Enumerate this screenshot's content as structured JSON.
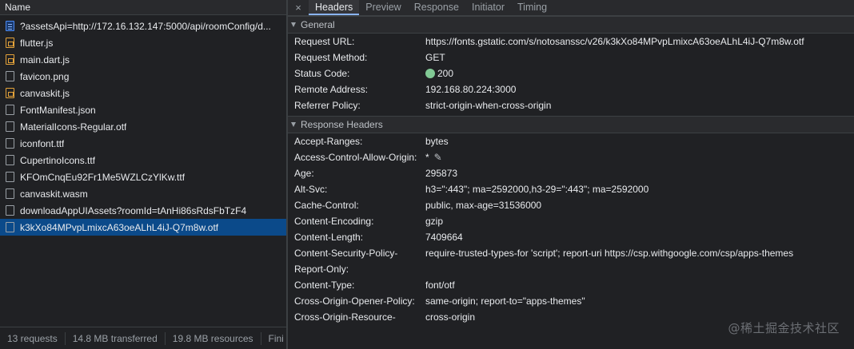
{
  "left": {
    "header": "Name",
    "files": [
      {
        "name": "?assetsApi=http://172.16.132.147:5000/api/roomConfig/d...",
        "icon": "doc"
      },
      {
        "name": "flutter.js",
        "icon": "js"
      },
      {
        "name": "main.dart.js",
        "icon": "js"
      },
      {
        "name": "favicon.png",
        "icon": "plain"
      },
      {
        "name": "canvaskit.js",
        "icon": "js"
      },
      {
        "name": "FontManifest.json",
        "icon": "plain"
      },
      {
        "name": "MaterialIcons-Regular.otf",
        "icon": "plain"
      },
      {
        "name": "iconfont.ttf",
        "icon": "plain"
      },
      {
        "name": "CupertinoIcons.ttf",
        "icon": "plain"
      },
      {
        "name": "KFOmCnqEu92Fr1Me5WZLCzYlKw.ttf",
        "icon": "plain"
      },
      {
        "name": "canvaskit.wasm",
        "icon": "plain"
      },
      {
        "name": "downloadAppUIAssets?roomId=tAnHi86sRdsFbTzF4",
        "icon": "plain"
      },
      {
        "name": "k3kXo84MPvpLmixcA63oeALhL4iJ-Q7m8w.otf",
        "icon": "plain",
        "selected": true
      }
    ],
    "status": {
      "requests": "13 requests",
      "transferred": "14.8 MB transferred",
      "resources": "19.8 MB resources",
      "finish": "Fini"
    }
  },
  "tabs": {
    "close": "×",
    "items": [
      "Headers",
      "Preview",
      "Response",
      "Initiator",
      "Timing"
    ],
    "active": "Headers"
  },
  "general": {
    "title": "General",
    "rows": [
      {
        "key": "Request URL:",
        "value": "https://fonts.gstatic.com/s/notosanssc/v26/k3kXo84MPvpLmixcA63oeALhL4iJ-Q7m8w.otf"
      },
      {
        "key": "Request Method:",
        "value": "GET"
      },
      {
        "key": "Status Code:",
        "value": "200"
      },
      {
        "key": "Remote Address:",
        "value": "192.168.80.224:3000"
      },
      {
        "key": "Referrer Policy:",
        "value": "strict-origin-when-cross-origin"
      }
    ]
  },
  "response_headers": {
    "title": "Response Headers",
    "rows": [
      {
        "key": "Accept-Ranges:",
        "value": "bytes"
      },
      {
        "key": "Access-Control-Allow-Origin:",
        "value": "*"
      },
      {
        "key": "Age:",
        "value": "295873"
      },
      {
        "key": "Alt-Svc:",
        "value": "h3=\":443\"; ma=2592000,h3-29=\":443\"; ma=2592000"
      },
      {
        "key": "Cache-Control:",
        "value": "public, max-age=31536000"
      },
      {
        "key": "Content-Encoding:",
        "value": "gzip"
      },
      {
        "key": "Content-Length:",
        "value": "7409664"
      },
      {
        "key": "Content-Security-Policy-",
        "value": "require-trusted-types-for 'script'; report-uri https://csp.withgoogle.com/csp/apps-themes"
      },
      {
        "key": "Report-Only:",
        "value": ""
      },
      {
        "key": "Content-Type:",
        "value": "font/otf"
      },
      {
        "key": "Cross-Origin-Opener-Policy:",
        "value": "same-origin; report-to=\"apps-themes\""
      },
      {
        "key": "Cross-Origin-Resource-",
        "value": "cross-origin"
      }
    ]
  },
  "watermark": "@稀土掘金技术社区",
  "colors": {
    "background": "#202124",
    "selected_row": "#0b4a8a",
    "status_ok": "#81c995",
    "active_tab_underline": "#8ab4f8"
  }
}
